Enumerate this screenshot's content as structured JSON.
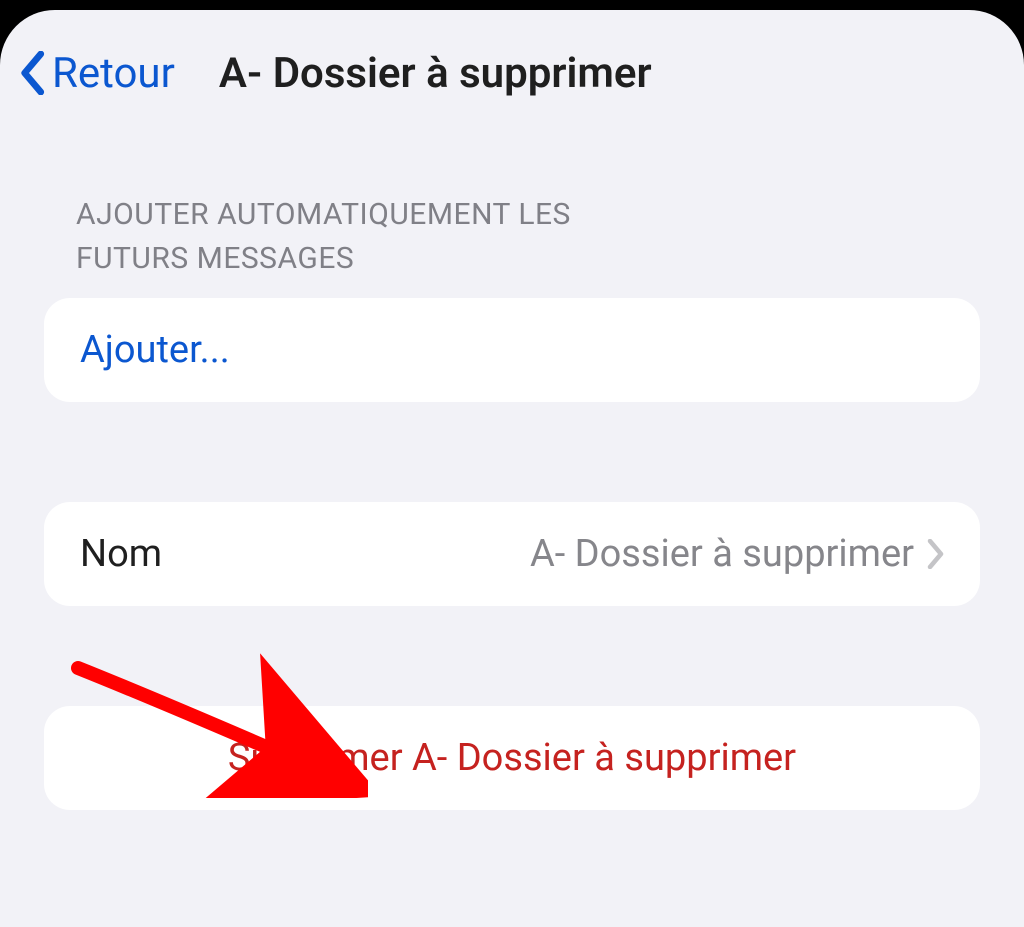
{
  "nav": {
    "back_label": "Retour",
    "title": "A- Dossier à supprimer"
  },
  "section1": {
    "header_line1": "AJOUTER AUTOMATIQUEMENT LES",
    "header_line2": "FUTURS MESSAGES",
    "add_label": "Ajouter..."
  },
  "section2": {
    "name_label": "Nom",
    "name_value": "A- Dossier à supprimer"
  },
  "section3": {
    "delete_label": "Supprimer A- Dossier à supprimer"
  },
  "colors": {
    "accent": "#0b57d0",
    "danger": "#c5221f",
    "bg": "#f2f2f7",
    "muted": "#808087",
    "value": "#86868b"
  }
}
